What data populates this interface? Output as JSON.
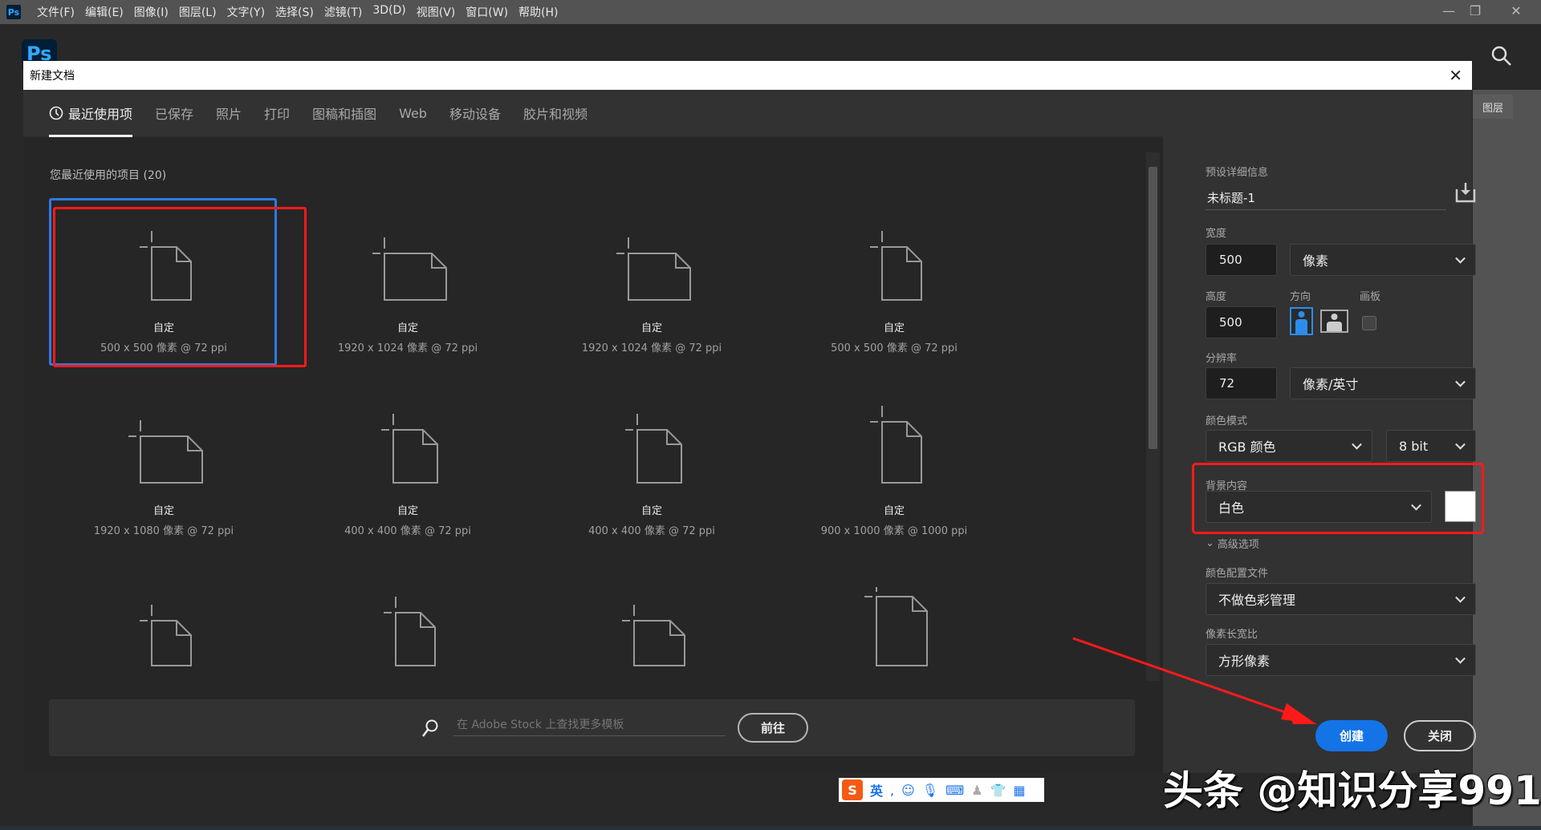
{
  "app": {
    "logo": "Ps",
    "menu": [
      "文件(F)",
      "编辑(E)",
      "图像(I)",
      "图层(L)",
      "文字(Y)",
      "选择(S)",
      "滤镜(T)",
      "3D(D)",
      "视图(V)",
      "窗口(W)",
      "帮助(H)"
    ],
    "layers_tab": "图层"
  },
  "dialog": {
    "title": "新建文档",
    "tabs": [
      "最近使用项",
      "已保存",
      "照片",
      "打印",
      "图稿和插图",
      "Web",
      "移动设备",
      "胶片和视频"
    ],
    "recent_title": "您最近使用的项目 (20)",
    "items": [
      {
        "name": "自定",
        "desc": "500 x 500 像素 @ 72 ppi"
      },
      {
        "name": "自定",
        "desc": "1920 x 1024 像素 @ 72 ppi"
      },
      {
        "name": "自定",
        "desc": "1920 x 1024 像素 @ 72 ppi"
      },
      {
        "name": "自定",
        "desc": "500 x 500 像素 @ 72 ppi"
      },
      {
        "name": "自定",
        "desc": "1920 x 1080 像素 @ 72 ppi"
      },
      {
        "name": "自定",
        "desc": "400 x 400 像素 @ 72 ppi"
      },
      {
        "name": "自定",
        "desc": "400 x 400 像素 @ 72 ppi"
      },
      {
        "name": "自定",
        "desc": "900 x 1000 像素 @ 1000 ppi"
      }
    ],
    "stock_placeholder": "在 Adobe Stock 上查找更多模板",
    "goto_label": "前往",
    "preset": {
      "heading": "预设详细信息",
      "doc_name": "未标题-1",
      "width_label": "宽度",
      "width": "500",
      "width_unit": "像素",
      "height_label": "高度",
      "height": "500",
      "orientation_label": "方向",
      "artboard_label": "画板",
      "resolution_label": "分辨率",
      "resolution": "72",
      "resolution_unit": "像素/英寸",
      "color_mode_label": "颜色模式",
      "color_mode": "RGB 颜色",
      "bit_depth": "8 bit",
      "bg_label": "背景内容",
      "bg": "白色",
      "bg_color": "#ffffff",
      "advanced": "高级选项",
      "profile_label": "颜色配置文件",
      "profile": "不做色彩管理",
      "aspect_label": "像素长宽比",
      "aspect": "方形像素",
      "create": "创建",
      "close": "关闭"
    }
  },
  "ime": {
    "lang": "英"
  },
  "watermark": "头条 @知识分享991",
  "colors": {
    "accent": "#1473e6",
    "annotation": "#ff1a1a",
    "selection": "#2d7be5"
  }
}
